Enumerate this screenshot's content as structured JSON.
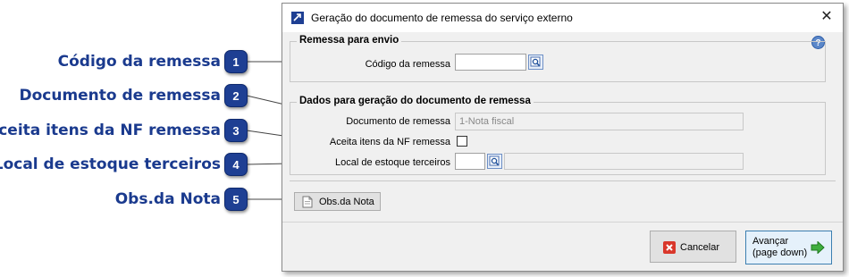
{
  "annotations": [
    {
      "number": "1",
      "label": "Código da remessa"
    },
    {
      "number": "2",
      "label": "Documento de remessa"
    },
    {
      "number": "3",
      "label": "Aceita itens da NF remessa"
    },
    {
      "number": "4",
      "label": "Local de estoque terceiros"
    },
    {
      "number": "5",
      "label": "Obs.da Nota"
    }
  ],
  "dialog": {
    "title": "Geração do documento de remessa do serviço externo",
    "close_glyph": "✕",
    "help_glyph": "?"
  },
  "group_remessa": {
    "legend": "Remessa para envio",
    "codigo_label": "Código da remessa",
    "codigo_value": ""
  },
  "group_dados": {
    "legend": "Dados para geração do documento de remessa",
    "documento_label": "Documento de remessa",
    "documento_value": "1-Nota fiscal",
    "aceita_label": "Aceita itens da NF remessa",
    "aceita_checked": false,
    "local_label": "Local de estoque terceiros",
    "local_code": "",
    "local_desc": ""
  },
  "buttons": {
    "obs_label": "Obs.da Nota",
    "cancelar_label": "Cancelar",
    "avancar_line1": "Avançar",
    "avancar_line2": "(page down)"
  },
  "colors": {
    "annotation_text": "#1a3a8e",
    "badge_bg": "#1e3f93",
    "dialog_bg": "#f0f0f0"
  }
}
